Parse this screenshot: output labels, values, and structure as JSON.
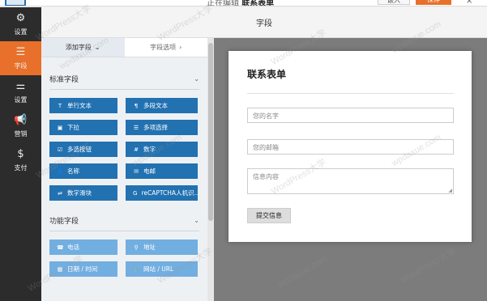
{
  "topbar": {
    "crumb_prefix": "正在编辑",
    "crumb_name": "联系表单",
    "secondary_button": "嵌入",
    "primary_button": "保存",
    "close": "×"
  },
  "sidebar": {
    "items": [
      {
        "label": "设置",
        "icon": "⚙"
      },
      {
        "label": "字段",
        "icon": "☰"
      },
      {
        "label": "设置",
        "icon": "⚌"
      },
      {
        "label": "营销",
        "icon": "📢"
      },
      {
        "label": "支付",
        "icon": "$"
      }
    ]
  },
  "header": {
    "title": "字段"
  },
  "panel": {
    "tabs": [
      {
        "label": "添加字段",
        "chev": "⌄"
      },
      {
        "label": "字段选项",
        "chev": "›"
      }
    ],
    "standard": {
      "title": "标准字段",
      "chev": "⌄",
      "buttons": [
        {
          "label": "单行文本",
          "icon": "T"
        },
        {
          "label": "多段文本",
          "icon": "¶"
        },
        {
          "label": "下拉",
          "icon": "▣"
        },
        {
          "label": "多项选择",
          "icon": "☰"
        },
        {
          "label": "多选按钮",
          "icon": "☑"
        },
        {
          "label": "数字",
          "icon": "#"
        },
        {
          "label": "名称",
          "icon": "👤"
        },
        {
          "label": "电邮",
          "icon": "✉"
        },
        {
          "label": "数字滑块",
          "icon": "⇌"
        },
        {
          "label": "reCAPTCHA人机识...",
          "icon": "G"
        }
      ]
    },
    "fancy": {
      "title": "功能字段",
      "chev": "⌄",
      "buttons": [
        {
          "label": "电话",
          "icon": "☎"
        },
        {
          "label": "地址",
          "icon": "⚲"
        },
        {
          "label": "日期 / 时间",
          "icon": "▦"
        },
        {
          "label": "网站 / URL",
          "icon": "🔗"
        }
      ]
    }
  },
  "form": {
    "title": "联系表单",
    "name_placeholder": "您的名字",
    "email_placeholder": "您的邮箱",
    "message_placeholder": "信息内容",
    "submit": "提交信息"
  },
  "watermark": {
    "text": "WordPress大学",
    "text2": "wpdaxue.com"
  },
  "colors": {
    "accent": "#e9702a",
    "button_blue": "#2271b1",
    "button_light": "#72aee0",
    "sidebar": "#2c2c2c"
  }
}
